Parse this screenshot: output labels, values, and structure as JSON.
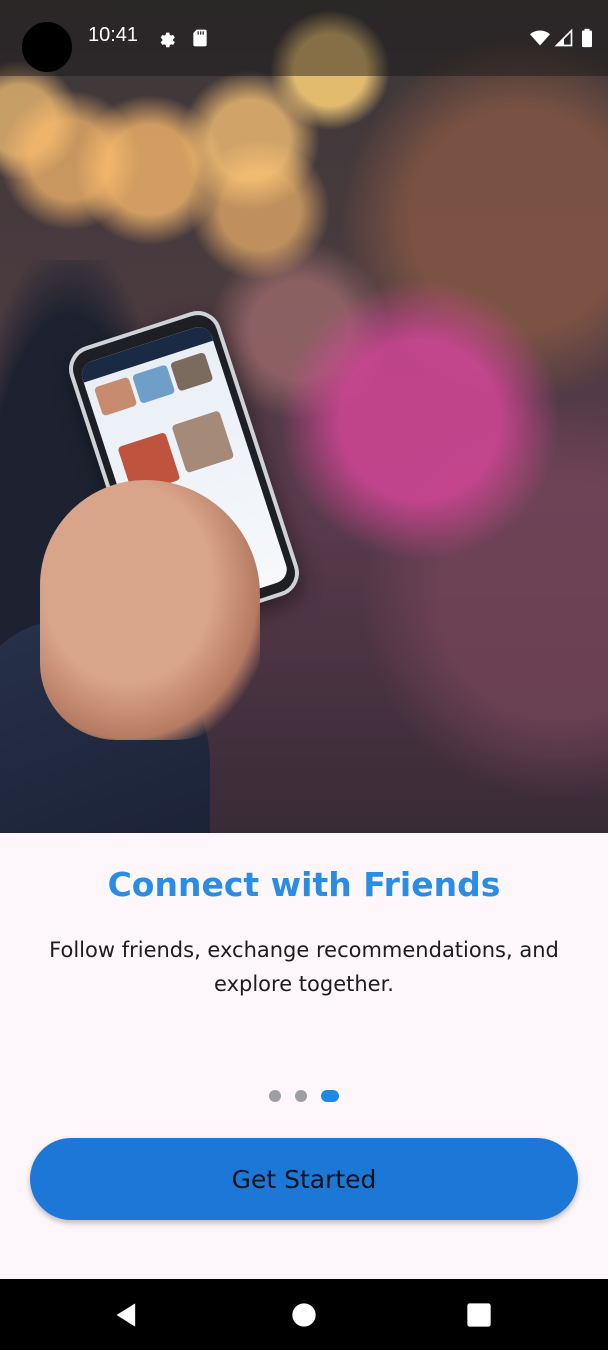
{
  "status_bar": {
    "time": "10:41",
    "icons": [
      "settings-icon",
      "sd-card-icon",
      "wifi-icon",
      "cellular-icon",
      "battery-icon"
    ]
  },
  "hero": {
    "image": "person-holding-phone-social-app-photo"
  },
  "onboarding": {
    "title": "Connect with Friends",
    "description": "Follow friends, exchange recommendations, and explore together.",
    "page_count": 3,
    "current_page": 3,
    "cta_label": "Get Started"
  },
  "nav_bar": {
    "buttons": [
      "back-icon",
      "home-icon",
      "recents-icon"
    ]
  },
  "colors": {
    "accent": "#2a8ce5",
    "button": "#1c77d6",
    "dot_inactive": "#9e9ea3",
    "background": "#fdf6fb"
  }
}
